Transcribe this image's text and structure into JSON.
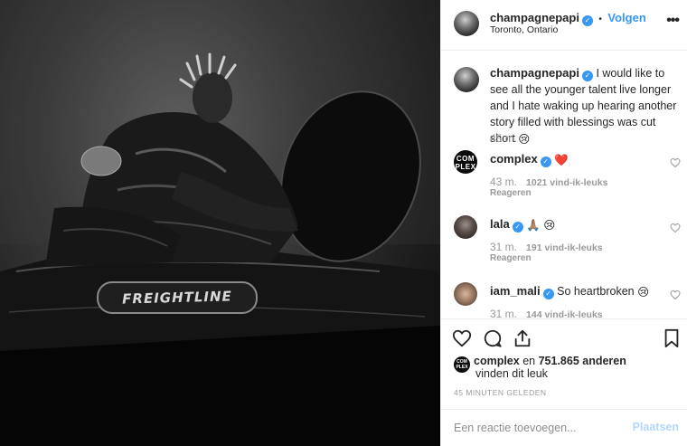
{
  "post": {
    "user": "champagnepapi",
    "follow_label": "Volgen",
    "separator": "•",
    "location": "Toronto, Ontario",
    "photo_text": "FREIGHTLINE"
  },
  "caption": {
    "user": "champagnepapi",
    "text": "I would like to see all the younger talent live longer and I hate waking up hearing another story filled with blessings was cut short",
    "emoji": "😢",
    "time": "45 m."
  },
  "comments": [
    {
      "user": "complex",
      "text": "",
      "emoji": "❤️",
      "avatar_text": "COM PLEX",
      "time": "43 m.",
      "likes": "1021 vind-ik-leuks",
      "reply": "Reageren"
    },
    {
      "user": "lala",
      "text": "",
      "emoji": "🙏🏽 😢",
      "avatar_text": "",
      "time": "31 m.",
      "likes": "191 vind-ik-leuks",
      "reply": "Reageren"
    },
    {
      "user": "iam_mali",
      "text": "So heartbroken",
      "emoji": "😢",
      "avatar_text": "",
      "time": "31 m.",
      "likes": "144 vind-ik-leuks",
      "reply": ""
    }
  ],
  "likes": {
    "avatar_text": "COM PLEX",
    "user": "complex",
    "connector": "en",
    "count": "751.865 anderen",
    "line2": "vinden dit leuk"
  },
  "posted_ago": "45 MINUTEN GELEDEN",
  "add_comment": {
    "placeholder": "Een reactie toevoegen...",
    "post_label": "Plaatsen"
  },
  "icons": {
    "more": "more-horizontal-icon",
    "like": "heart-icon",
    "comment": "comment-bubble-icon",
    "share": "share-icon",
    "save": "bookmark-icon",
    "verified": "verified-badge-icon"
  },
  "colors": {
    "link_blue": "#3897f0",
    "muted_gray": "#999999",
    "post_disabled": "#b3d6fb"
  }
}
